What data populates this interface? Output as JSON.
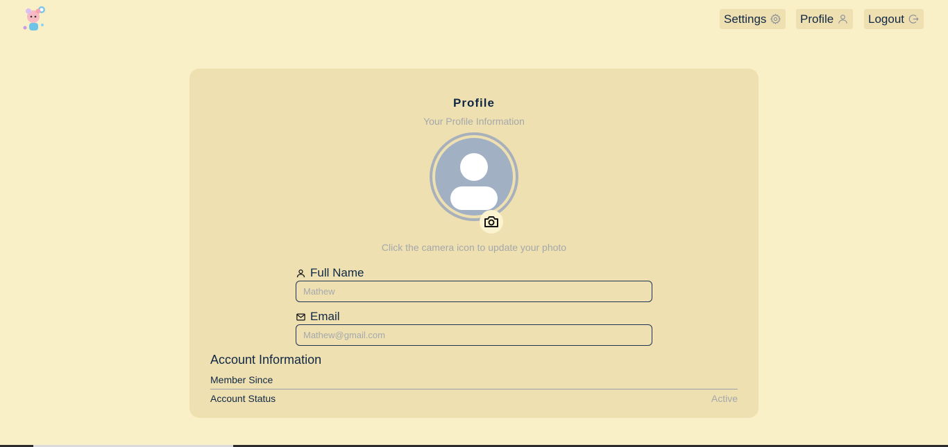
{
  "header": {
    "nav": {
      "settings_label": "Settings",
      "profile_label": "Profile",
      "logout_label": "Logout"
    },
    "icons": {
      "logo": "cartoon-character-logo",
      "settings": "gear-icon",
      "profile": "user-icon",
      "logout": "logout-icon"
    }
  },
  "profile_card": {
    "title": "Profile",
    "subtitle": "Your Profile Information",
    "camera_hint": "Click the camera icon to update your photo",
    "fields": {
      "full_name": {
        "label": "Full Name",
        "placeholder": "Mathew",
        "value": ""
      },
      "email": {
        "label": "Email",
        "placeholder": "Mathew@gmail.com",
        "value": ""
      }
    },
    "account_info": {
      "title": "Account Information",
      "member_since_label": "Member Since",
      "member_since_value": "",
      "status_label": "Account Status",
      "status_value": "Active"
    }
  },
  "colors": {
    "background": "#faf0c8",
    "card": "#efe0b2",
    "text": "#0f2744",
    "muted": "#a4a8ab",
    "avatar": "#a2b0c4"
  }
}
